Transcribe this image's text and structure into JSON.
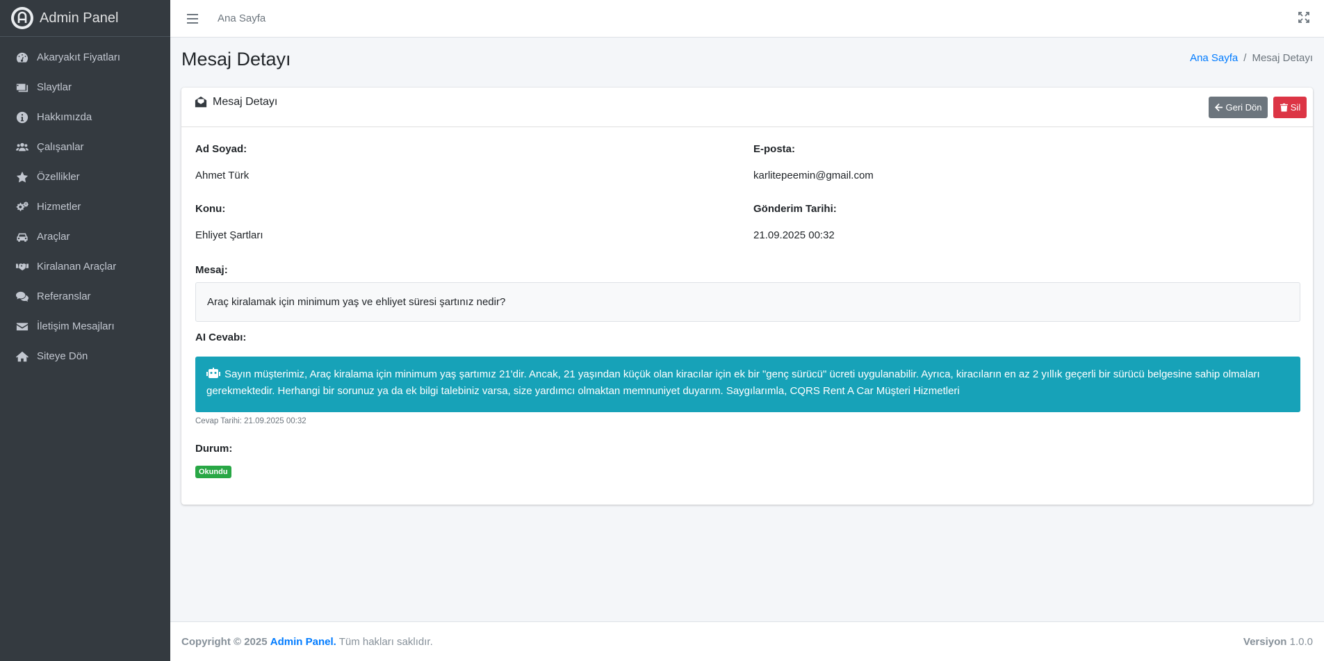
{
  "brand": {
    "name": "Admin Panel"
  },
  "sidebar": {
    "items": [
      {
        "label": "Akaryakıt Fiyatları",
        "icon": "gauge-icon"
      },
      {
        "label": "Slaytlar",
        "icon": "images-icon"
      },
      {
        "label": "Hakkımızda",
        "icon": "info-circle-icon"
      },
      {
        "label": "Çalışanlar",
        "icon": "users-icon"
      },
      {
        "label": "Özellikler",
        "icon": "star-icon"
      },
      {
        "label": "Hizmetler",
        "icon": "cogs-icon"
      },
      {
        "label": "Araçlar",
        "icon": "car-icon"
      },
      {
        "label": "Kiralanan Araçlar",
        "icon": "handshake-icon"
      },
      {
        "label": "Referanslar",
        "icon": "comments-icon"
      },
      {
        "label": "İletişim Mesajları",
        "icon": "envelope-icon"
      },
      {
        "label": "Siteye Dön",
        "icon": "home-icon"
      }
    ]
  },
  "topbar": {
    "home_link": "Ana Sayfa"
  },
  "page": {
    "title": "Mesaj Detayı",
    "breadcrumb": {
      "home": "Ana Sayfa",
      "separator": "/",
      "current": "Mesaj Detayı"
    }
  },
  "card": {
    "title": "Mesaj Detayı",
    "back_label": "Geri Dön",
    "delete_label": "Sil",
    "fields": {
      "name_label": "Ad Soyad:",
      "name_value": "Ahmet Türk",
      "email_label": "E-posta:",
      "email_value": "karlitepeemin@gmail.com",
      "subject_label": "Konu:",
      "subject_value": "Ehliyet Şartları",
      "date_label": "Gönderim Tarihi:",
      "date_value": "21.09.2025 00:32",
      "message_label": "Mesaj:",
      "message_value": "Araç kiralamak için minimum yaş ve ehliyet süresi şartınız nedir?",
      "ai_label": "AI Cevabı:",
      "ai_value": "Sayın müşterimiz, Araç kiralama için minimum yaş şartımız 21'dir. Ancak, 21 yaşından küçük olan kiracılar için ek bir \"genç sürücü\" ücreti uygulanabilir. Ayrıca, kiracıların en az 2 yıllık geçerli bir sürücü belgesine sahip olmaları gerekmektedir. Herhangi bir sorunuz ya da ek bilgi talebiniz varsa, size yardımcı olmaktan memnuniyet duyarım. Saygılarımla, CQRS Rent A Car Müşteri Hizmetleri",
      "answer_date": "Cevap Tarihi: 21.09.2025 00:32",
      "status_label": "Durum:",
      "status_value": "Okundu"
    }
  },
  "footer": {
    "copyright": "Copyright © 2025",
    "brand": "Admin Panel.",
    "rights": "Tüm hakları saklıdır.",
    "version_label": "Versiyon",
    "version_value": "1.0.0"
  },
  "colors": {
    "sidebar_bg": "#343a40",
    "primary": "#007bff",
    "secondary": "#6c757d",
    "danger": "#dc3545",
    "info": "#17a2b8",
    "success": "#28a745"
  }
}
